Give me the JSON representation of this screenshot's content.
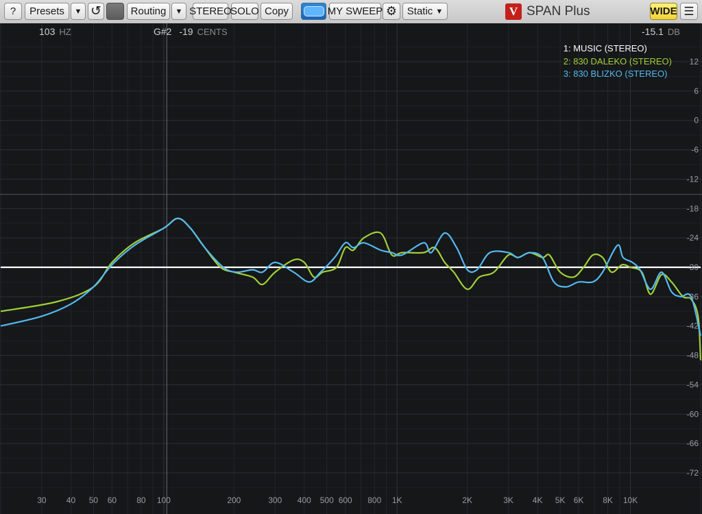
{
  "toolbar": {
    "help_label": "?",
    "presets_label": "Presets",
    "reset_icon": "reset-icon",
    "routing_label": "Routing",
    "stereo_label": "STEREO",
    "solo_label": "SOLO",
    "copy_label": "Copy",
    "sweep_label": "MY SWEEP",
    "gear_icon": "gear-icon",
    "mode_label": "Static",
    "brand_logo": "V",
    "app_title": "SPAN Plus",
    "wide_label": "WIDE",
    "menu_icon": "hamburger-menu-icon"
  },
  "readout": {
    "freq_value": "103",
    "freq_unit": "HZ",
    "note_value": "G#2",
    "cents_value": "-19",
    "cents_unit": "CENTS",
    "level_value": "-15.1",
    "level_unit": "DB"
  },
  "colors": {
    "music": "#ffffff",
    "daleko": "#a3cf37",
    "blizko": "#55b9f2",
    "plot_bg": "#151719",
    "grid": "#2b2f33"
  },
  "chart_data": {
    "type": "line",
    "x_scale": "log",
    "xlim": [
      20,
      20000
    ],
    "ylim": [
      -75,
      15
    ],
    "grid": true,
    "legend_position": "top-right",
    "x_tick_labels": [
      "30",
      "40",
      "50",
      "60",
      "80",
      "100",
      "200",
      "300",
      "400",
      "500",
      "600",
      "800",
      "1K",
      "2K",
      "3K",
      "4K",
      "5K",
      "6K",
      "8K",
      "10K"
    ],
    "x_tick_values": [
      30,
      40,
      50,
      60,
      80,
      100,
      200,
      300,
      400,
      500,
      600,
      800,
      1000,
      2000,
      3000,
      4000,
      5000,
      6000,
      8000,
      10000
    ],
    "y_tick_labels": [
      "12",
      "6",
      "0",
      "-6",
      "-12",
      "-18",
      "-24",
      "-30",
      "-36",
      "-42",
      "-48",
      "-54",
      "-60",
      "-66",
      "-72"
    ],
    "y_tick_values": [
      12,
      6,
      0,
      -6,
      -12,
      -18,
      -24,
      -30,
      -36,
      -42,
      -48,
      -54,
      -60,
      -66,
      -72
    ],
    "series": [
      {
        "name": "1: MUSIC (STEREO)",
        "color": "#ffffff",
        "points": [
          [
            20,
            -30
          ],
          [
            100,
            -30
          ],
          [
            1000,
            -30
          ],
          [
            10000,
            -30
          ],
          [
            20000,
            -30
          ]
        ]
      },
      {
        "name": "2: 830 DALEKO (STEREO)",
        "color": "#a3cf37",
        "points": [
          [
            20,
            -39
          ],
          [
            35,
            -37
          ],
          [
            50,
            -34
          ],
          [
            60,
            -29
          ],
          [
            75,
            -25
          ],
          [
            100,
            -22
          ],
          [
            115,
            -20
          ],
          [
            130,
            -22
          ],
          [
            150,
            -26
          ],
          [
            175,
            -30
          ],
          [
            200,
            -31
          ],
          [
            240,
            -32
          ],
          [
            265,
            -33.5
          ],
          [
            300,
            -31
          ],
          [
            360,
            -28.5
          ],
          [
            400,
            -29
          ],
          [
            440,
            -32
          ],
          [
            480,
            -31
          ],
          [
            550,
            -30
          ],
          [
            600,
            -26
          ],
          [
            650,
            -26.5
          ],
          [
            720,
            -24
          ],
          [
            850,
            -23
          ],
          [
            950,
            -27.5
          ],
          [
            1050,
            -27
          ],
          [
            1300,
            -27
          ],
          [
            1450,
            -26
          ],
          [
            1600,
            -29
          ],
          [
            1750,
            -31
          ],
          [
            2000,
            -34.5
          ],
          [
            2250,
            -32
          ],
          [
            2600,
            -31
          ],
          [
            3000,
            -27.5
          ],
          [
            3300,
            -28
          ],
          [
            3700,
            -27
          ],
          [
            4200,
            -28
          ],
          [
            4500,
            -27.5
          ],
          [
            5000,
            -31
          ],
          [
            5700,
            -32
          ],
          [
            6300,
            -30
          ],
          [
            6900,
            -27.5
          ],
          [
            7600,
            -28
          ],
          [
            8300,
            -31
          ],
          [
            9200,
            -29.5
          ],
          [
            10000,
            -30
          ],
          [
            11200,
            -31
          ],
          [
            12200,
            -35.5
          ],
          [
            13600,
            -31.5
          ],
          [
            15000,
            -33
          ],
          [
            16800,
            -36
          ],
          [
            18200,
            -36.5
          ],
          [
            19500,
            -40
          ],
          [
            20000,
            -49
          ]
        ]
      },
      {
        "name": "3: 830 BLIZKO (STEREO)",
        "color": "#55b9f2",
        "points": [
          [
            20,
            -42
          ],
          [
            30,
            -40
          ],
          [
            40,
            -37.5
          ],
          [
            50,
            -34
          ],
          [
            60,
            -29.5
          ],
          [
            75,
            -25.5
          ],
          [
            100,
            -22
          ],
          [
            115,
            -20
          ],
          [
            130,
            -22
          ],
          [
            150,
            -26
          ],
          [
            180,
            -30
          ],
          [
            205,
            -31
          ],
          [
            240,
            -30.5
          ],
          [
            265,
            -31
          ],
          [
            300,
            -29
          ],
          [
            360,
            -31
          ],
          [
            420,
            -33
          ],
          [
            470,
            -31
          ],
          [
            540,
            -28
          ],
          [
            600,
            -25
          ],
          [
            650,
            -26
          ],
          [
            720,
            -25
          ],
          [
            850,
            -26.5
          ],
          [
            950,
            -27
          ],
          [
            1050,
            -27.5
          ],
          [
            1300,
            -25
          ],
          [
            1400,
            -27
          ],
          [
            1600,
            -23
          ],
          [
            1800,
            -26
          ],
          [
            2000,
            -30.5
          ],
          [
            2200,
            -30.5
          ],
          [
            2500,
            -27
          ],
          [
            3000,
            -27
          ],
          [
            3300,
            -28
          ],
          [
            3700,
            -27
          ],
          [
            4200,
            -28
          ],
          [
            4700,
            -33
          ],
          [
            5300,
            -34
          ],
          [
            6000,
            -33
          ],
          [
            6900,
            -33
          ],
          [
            7600,
            -31
          ],
          [
            8800,
            -25.5
          ],
          [
            9300,
            -28
          ],
          [
            10200,
            -29
          ],
          [
            11000,
            -30.5
          ],
          [
            12200,
            -34.5
          ],
          [
            13600,
            -31
          ],
          [
            15000,
            -35
          ],
          [
            16400,
            -36
          ],
          [
            18200,
            -36
          ],
          [
            20000,
            -44
          ]
        ]
      }
    ]
  }
}
